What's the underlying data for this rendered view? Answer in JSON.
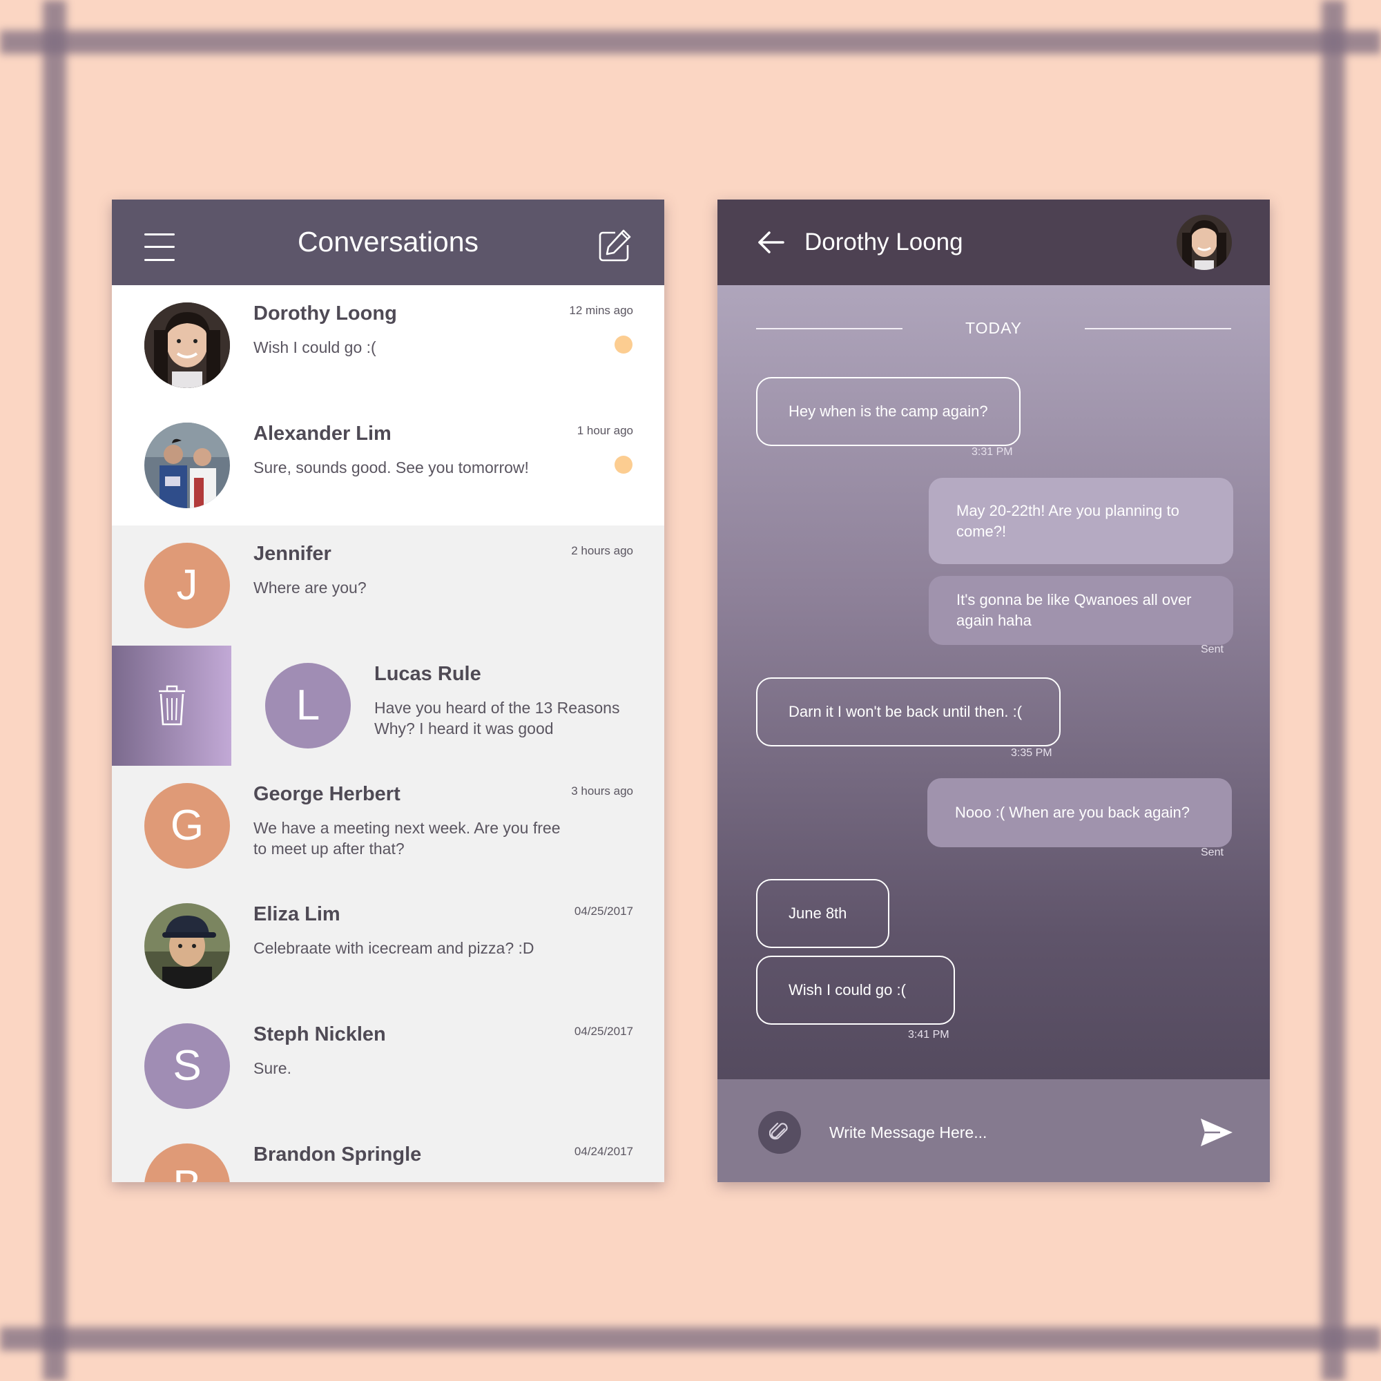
{
  "conversations": {
    "title": "Conversations",
    "items": [
      {
        "name": "Dorothy Loong",
        "preview": "Wish I could go :(",
        "time": "12 mins ago",
        "avatar": "photo-dorothy"
      },
      {
        "name": "Alexander Lim",
        "preview": "Sure, sounds good. See you tomorrow!",
        "time": "1 hour ago",
        "avatar": "photo-alexander"
      },
      {
        "name": "Jennifer",
        "preview": "Where are you?",
        "time": "2 hours ago",
        "initial": "J"
      },
      {
        "name": "Lucas Rule",
        "preview": "Have you heard of the 13 Reasons Why? I heard it was good",
        "initial": "L"
      },
      {
        "name": "George Herbert",
        "preview": "We have a meeting next week. Are you free to meet up after that?",
        "time": "3 hours ago",
        "initial": "G"
      },
      {
        "name": "Eliza Lim",
        "preview": "Celebraate with  icecream and pizza? :D",
        "time": "04/25/2017",
        "avatar": "photo-eliza"
      },
      {
        "name": "Steph Nicklen",
        "preview": "Sure.",
        "time": "04/25/2017",
        "initial": "S"
      },
      {
        "name": "Brandon Springle",
        "time": "04/24/2017",
        "initial": "B"
      }
    ]
  },
  "chat": {
    "contact_name": "Dorothy Loong",
    "day_label": "TODAY",
    "messages": [
      {
        "direction": "received",
        "text": "Hey when is the camp again?",
        "time": "3:31 PM"
      },
      {
        "direction": "sent",
        "text": "May 20-22th! Are you planning to come?!"
      },
      {
        "direction": "sent",
        "text": "It's gonna be like Qwanoes all over again haha",
        "status": "Sent"
      },
      {
        "direction": "received",
        "text": "Darn it I won't be back until then. :(",
        "time": "3:35 PM"
      },
      {
        "direction": "sent",
        "text": "Nooo :( When are you back again?",
        "status": "Sent"
      },
      {
        "direction": "received",
        "text": "June 8th"
      },
      {
        "direction": "received",
        "text": "Wish I could go :(",
        "time": "3:41 PM"
      }
    ],
    "composer_placeholder": "Write Message Here..."
  },
  "colors": {
    "header": "#5d566a",
    "unread_dot": "#fccd91",
    "avatar_orange": "#df9a77",
    "avatar_purple": "#a08db4",
    "page_background": "#fbd6c3"
  },
  "icons": {
    "menu": "hamburger-icon",
    "compose": "compose-icon",
    "delete": "trash-icon",
    "back": "back-arrow-icon",
    "attach": "paperclip-icon",
    "send": "send-icon"
  }
}
